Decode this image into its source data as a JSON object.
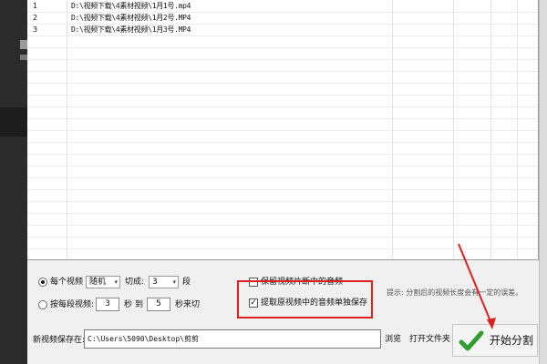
{
  "file_list": {
    "rows": [
      {
        "index": "1",
        "path": "D:\\视频下载\\4素材视频\\1月1号.mp4"
      },
      {
        "index": "2",
        "path": "D:\\视频下载\\4素材视频\\1月2号.MP4"
      },
      {
        "index": "3",
        "path": "D:\\视频下载\\4素材视频\\1月3号.MP4"
      }
    ]
  },
  "split_options": {
    "per_video_label": "每个视频",
    "mode_value": "随机",
    "cut_label": "切成:",
    "count_value": "3",
    "segments_label": "段",
    "per_segment_label": "按每段视频:",
    "from_value": "3",
    "sec_label": "秒",
    "to_label": "到",
    "to_value": "5",
    "end_label": "秒来切"
  },
  "audio_options": {
    "keep_audio_label": "保留视频片断中的音频",
    "extract_audio_label": "提取原视频中的音频单独保存"
  },
  "hint": "提示: 分割后的视频长度会有一定的误差。",
  "save": {
    "label": "新视频保存在:",
    "path_value": "C:\\Users\\5090\\Desktop\\剪剪",
    "browse_label": "浏览",
    "open_folder_label": "打开文件夹"
  },
  "start_button_label": "开始分割",
  "colors": {
    "highlight": "#e02020",
    "check_green": "#2f9e2f"
  }
}
